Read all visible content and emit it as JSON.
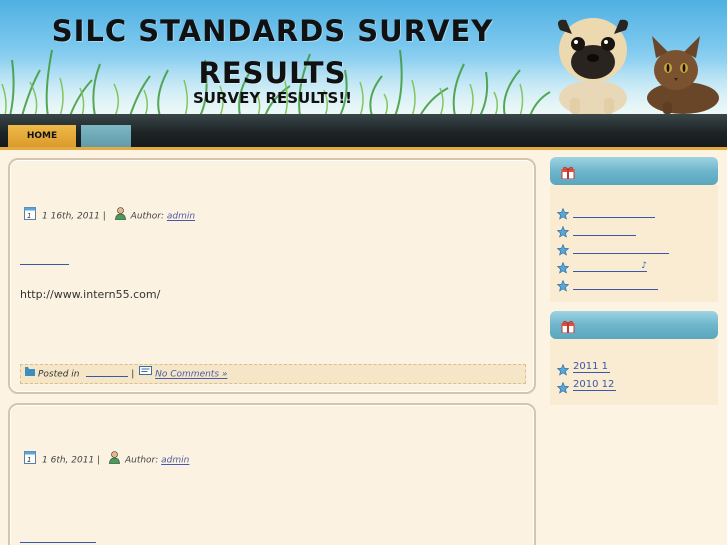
{
  "header": {
    "title_line1": "SILC STANDARDS SURVEY",
    "title_line2": "RESULTS",
    "subtitle": "SURVEY RESULTS!!"
  },
  "nav": {
    "items": [
      {
        "label": "HOME",
        "active": true
      },
      {
        "label": "",
        "active": false
      }
    ]
  },
  "posts": [
    {
      "date": "1   16th, 2011 |",
      "author_prefix": "Author:",
      "author": "admin",
      "body_text": "http://www.intern55.com/",
      "posted_in": "Posted in",
      "separator": "|",
      "comments": "No Comments »"
    },
    {
      "date": "1   6th, 2011 |",
      "author_prefix": "Author:",
      "author": "admin"
    }
  ],
  "sidebar": {
    "widget1_items": [
      {
        "text": ""
      },
      {
        "text": ""
      },
      {
        "text": ""
      },
      {
        "text": "♪"
      },
      {
        "text": ""
      }
    ],
    "archives": [
      {
        "text": "2011 1"
      },
      {
        "text": "2010 12"
      }
    ]
  },
  "colors": {
    "header_sky": "#4fb0e2",
    "nav_bg": "#1d2426",
    "nav_active": "#e3a943",
    "nav_tab2": "#6ea8b6",
    "page_bg": "#fdf3e3",
    "link": "#3a57a8",
    "sidebar_head": "#6db6cc"
  },
  "icons": [
    "calendar-icon",
    "user-icon",
    "folder-icon",
    "comment-icon",
    "gift-icon",
    "star-icon"
  ]
}
